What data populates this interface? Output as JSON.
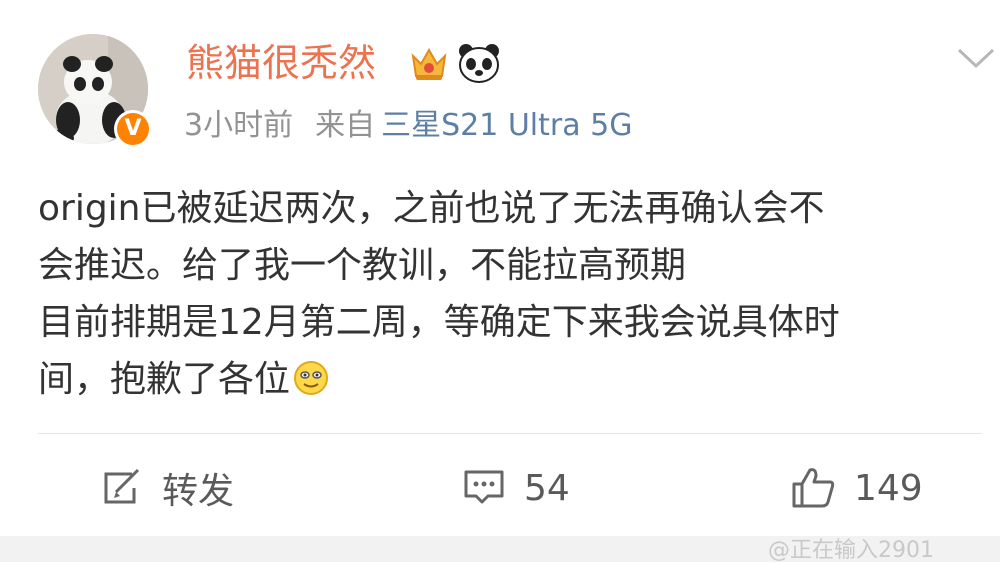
{
  "user": {
    "name": "熊猫很秃然",
    "verified_mark": "V"
  },
  "meta": {
    "time": "3小时前",
    "from_label": "来自",
    "device": "三星S21 Ultra 5G"
  },
  "post": {
    "line1": "origin已被延迟两次，之前也说了无法再确认会不",
    "line2": "会推迟。给了我一个教训，不能拉高预期",
    "line3": "目前排期是12月第二周，等确定下来我会说具体时",
    "line4": "间，抱歉了各位"
  },
  "actions": {
    "repost_label": "转发",
    "comment_count": "54",
    "like_count": "149"
  },
  "watermark": {
    "text": "@正在输入2901"
  },
  "icons": [
    "chevron-down-icon",
    "crown-icon",
    "panda-icon",
    "smile-emoji-icon",
    "repost-icon",
    "comment-icon",
    "like-icon"
  ],
  "colors": {
    "username": "#eb7350",
    "device_link": "#5d7fa6",
    "muted": "#939393",
    "verified": "#ff8200"
  }
}
